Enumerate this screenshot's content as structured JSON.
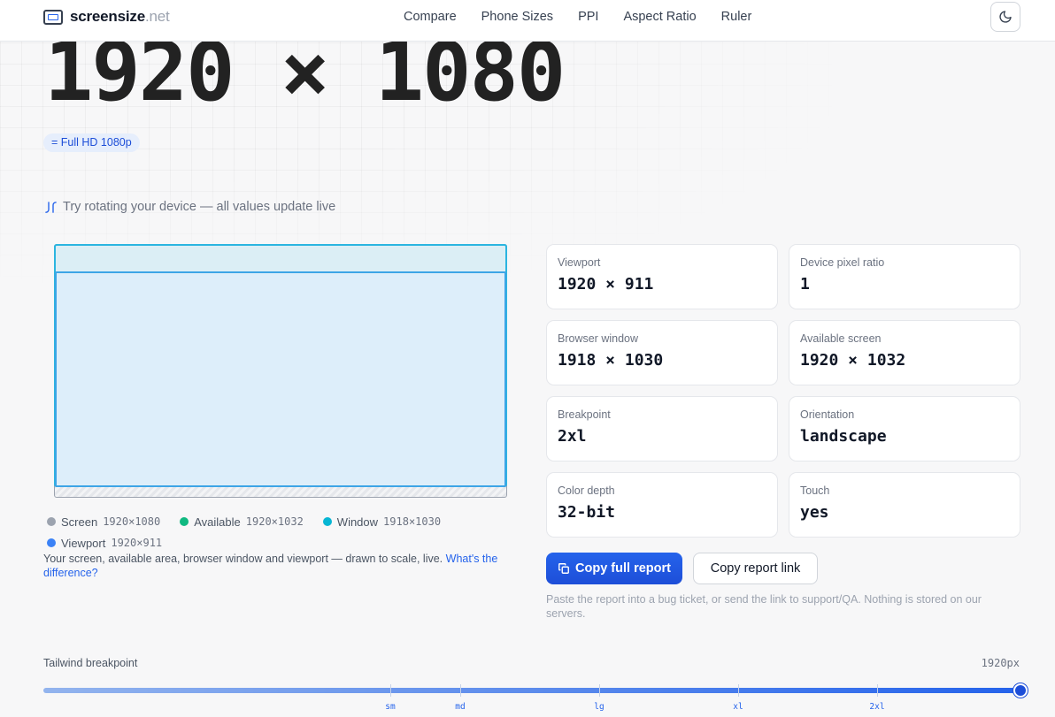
{
  "header": {
    "logo_name": "screensize",
    "logo_tld": ".net",
    "nav": [
      "Compare",
      "Phone Sizes",
      "PPI",
      "Aspect Ratio",
      "Ruler"
    ]
  },
  "hero": {
    "resolution": "1920 × 1080",
    "badge": "= Full HD 1080p",
    "rotate_hint": "Try rotating your device — all values update live"
  },
  "diagram": {
    "legend": [
      {
        "label": "Screen",
        "value": "1920×1080",
        "color": "#9ca3af"
      },
      {
        "label": "Available",
        "value": "1920×1032",
        "color": "#10b981"
      },
      {
        "label": "Window",
        "value": "1918×1030",
        "color": "#06b6d4"
      },
      {
        "label": "Viewport",
        "value": "1920×911",
        "color": "#3b82f6"
      }
    ],
    "caption": "Your screen, available area, browser window and viewport — drawn to scale, live.",
    "caption_link": "What's the difference?"
  },
  "stats": [
    {
      "label": "Viewport",
      "value": "1920 × 911"
    },
    {
      "label": "Device pixel ratio",
      "value": "1"
    },
    {
      "label": "Browser window",
      "value": "1918 × 1030"
    },
    {
      "label": "Available screen",
      "value": "1920 × 1032"
    },
    {
      "label": "Breakpoint",
      "value": "2xl"
    },
    {
      "label": "Orientation",
      "value": "landscape"
    },
    {
      "label": "Color depth",
      "value": "32-bit"
    },
    {
      "label": "Touch",
      "value": "yes"
    }
  ],
  "actions": {
    "copy_full_report": "Copy full report",
    "copy_report_link": "Copy report link",
    "note": "Paste the report into a bug ticket, or send the link to support/QA. Nothing is stored on our servers."
  },
  "breakpoint_bar": {
    "label": "Tailwind breakpoint",
    "value": "1920px",
    "ticks": [
      "sm",
      "md",
      "lg",
      "xl",
      "2xl"
    ]
  },
  "colors": {
    "accent": "#2563eb",
    "available_border": "#2bb5e0",
    "window_border": "#3da5e6"
  }
}
